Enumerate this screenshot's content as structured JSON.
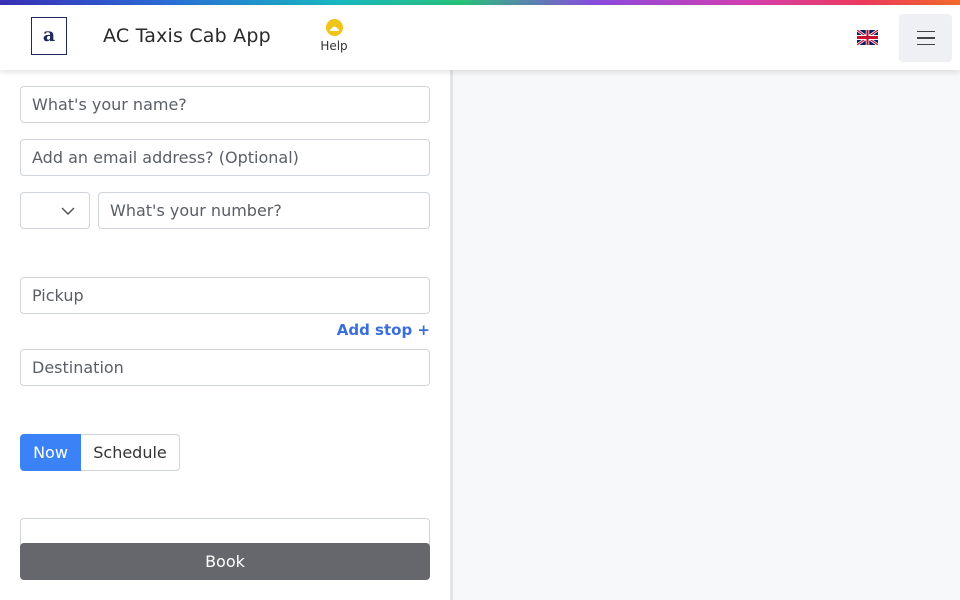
{
  "header": {
    "logo_letter": "a",
    "app_title": "AC Taxis Cab App",
    "help_label": "Help",
    "language_flag": "uk-flag-icon",
    "menu_icon": "hamburger-icon"
  },
  "colors": {
    "accent": "#3b82f6",
    "link": "#3a6fd8",
    "book_button": "#65676c",
    "help_icon": "#f0c419"
  },
  "form": {
    "name_placeholder": "What's your name?",
    "email_placeholder": "Add an email address? (Optional)",
    "country_code_value": "",
    "number_placeholder": "What's your number?",
    "pickup_placeholder": "Pickup",
    "add_stop_label": "Add stop +",
    "destination_placeholder": "Destination",
    "timing_options": [
      "Now",
      "Schedule"
    ],
    "timing_selected": "Now",
    "book_label": "Book"
  }
}
